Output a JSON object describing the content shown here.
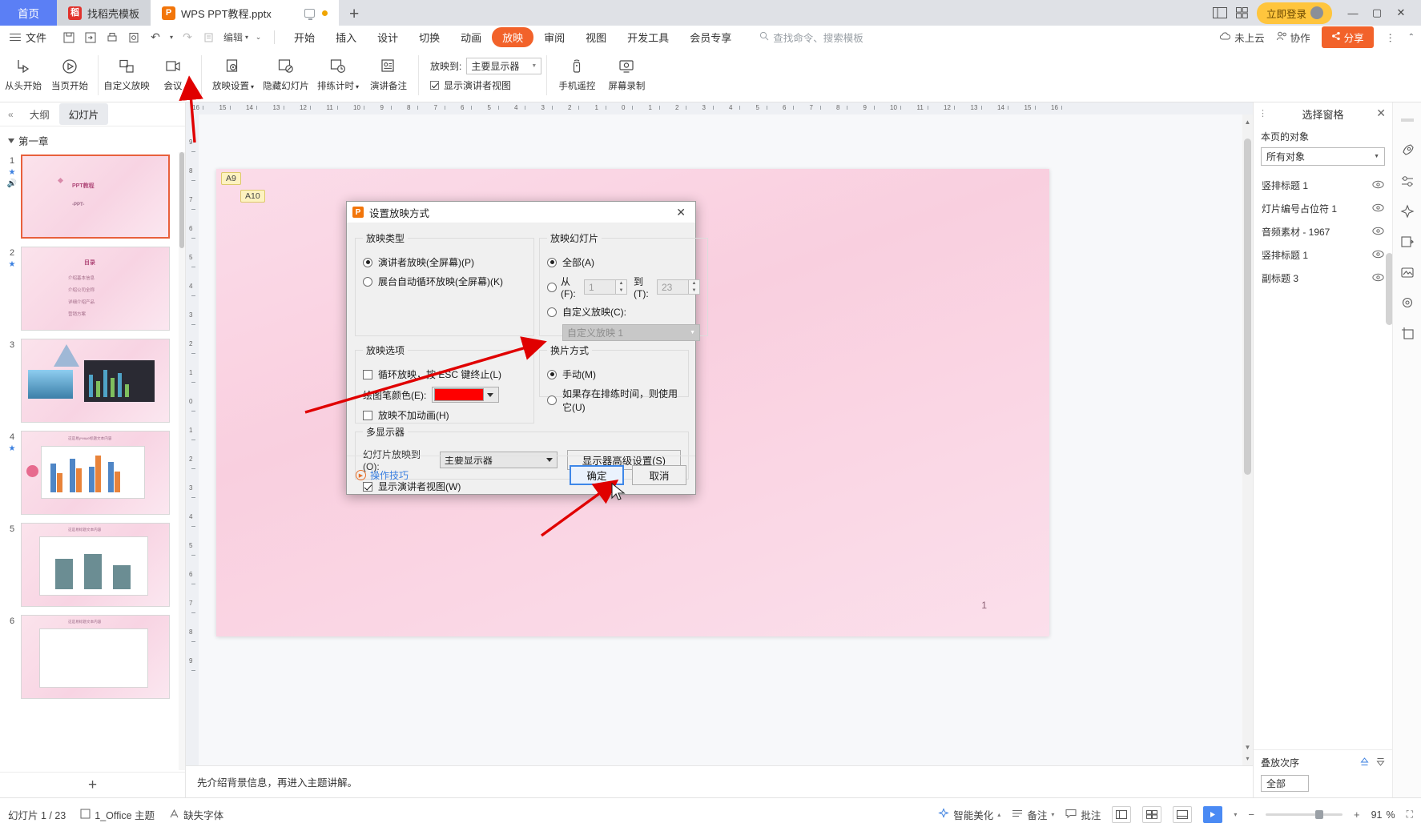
{
  "window": {
    "tabs": [
      {
        "label": "首页",
        "icon": "home-icon",
        "type": "home"
      },
      {
        "label": "找稻壳模板",
        "icon": "daoke-icon",
        "type": "gray"
      },
      {
        "label": "WPS PPT教程.pptx",
        "icon": "wps-ppt-icon",
        "type": "active"
      }
    ],
    "new_tab": "+",
    "login_label": "立即登录",
    "minimize": "—",
    "maximize": "▢",
    "close": "✕"
  },
  "menubar": {
    "file_label": "文件",
    "edit_label": "编辑",
    "tabs": [
      "开始",
      "插入",
      "设计",
      "切换",
      "动画",
      "放映",
      "审阅",
      "视图",
      "开发工具",
      "会员专享"
    ],
    "selected_tab": "放映",
    "search_placeholder": "查找命令、搜索模板",
    "cloud_label": "未上云",
    "collab_label": "协作",
    "share_label": "分享"
  },
  "ribbon": {
    "items": [
      {
        "label": "从头开始",
        "icon": "play-from-start-icon"
      },
      {
        "label": "当页开始",
        "icon": "play-from-current-icon"
      },
      {
        "label": "自定义放映",
        "icon": "custom-show-icon"
      },
      {
        "label": "会议",
        "icon": "meeting-icon"
      },
      {
        "label": "放映设置",
        "icon": "show-settings-icon",
        "dropdown": true
      },
      {
        "label": "隐藏幻灯片",
        "icon": "hide-slide-icon"
      },
      {
        "label": "排练计时",
        "icon": "rehearse-timing-icon",
        "dropdown": true
      },
      {
        "label": "演讲备注",
        "icon": "speaker-notes-icon"
      }
    ],
    "show_to_label": "放映到:",
    "show_to_value": "主要显示器",
    "presenter_view_label": "显示演讲者视图",
    "presenter_view_checked": true,
    "phone_remote": "手机遥控",
    "screen_record": "屏幕录制"
  },
  "left_panel": {
    "tab_outline": "大纲",
    "tab_slides": "幻灯片",
    "selected_tab": "幻灯片",
    "chapter": "第一章",
    "slides": [
      {
        "number": "1",
        "starred": true,
        "audio": true,
        "title": "PPT教程",
        "subtitle": "-PPT-"
      },
      {
        "number": "2",
        "starred": true,
        "title": "目录",
        "bullets": [
          "介绍基本信息",
          "介绍公司全称",
          "详细介绍产品",
          "营销方案"
        ]
      },
      {
        "number": "3",
        "starred": false,
        "title": ""
      },
      {
        "number": "4",
        "starred": true,
        "title": "这是易учные标题文本内容"
      },
      {
        "number": "5",
        "starred": false,
        "title": "这是易标题文本内容"
      },
      {
        "number": "6",
        "starred": false,
        "title": "这是易标题文本内容"
      }
    ],
    "add_slide": "+"
  },
  "ruler": {
    "h_ticks": [
      "16",
      "15",
      "14",
      "13",
      "12",
      "11",
      "10",
      "9",
      "8",
      "7",
      "6",
      "5",
      "4",
      "3",
      "2",
      "1",
      "0",
      "1",
      "2",
      "3",
      "4",
      "5",
      "6",
      "7",
      "8",
      "9",
      "10",
      "11",
      "12",
      "13",
      "14",
      "15",
      "16"
    ],
    "v_ticks": [
      "9",
      "8",
      "7",
      "6",
      "5",
      "4",
      "3",
      "2",
      "1",
      "0",
      "1",
      "2",
      "3",
      "4",
      "5",
      "6",
      "7",
      "8",
      "9"
    ]
  },
  "canvas": {
    "tags": [
      {
        "label": "A9"
      },
      {
        "label": "A10"
      }
    ],
    "slide_number": "1"
  },
  "dialog": {
    "title": "设置放映方式",
    "close": "✕",
    "show_type": {
      "legend": "放映类型",
      "options": [
        {
          "label": "演讲者放映(全屏幕)(P)",
          "selected": true
        },
        {
          "label": "展台自动循环放映(全屏幕)(K)",
          "selected": false
        }
      ]
    },
    "show_options": {
      "legend": "放映选项",
      "loop_label": "循环放映，按 ESC 键终止(L)",
      "loop_checked": false,
      "pen_color_label": "绘图笔颜色(E):",
      "pen_color": "#fe0000",
      "no_anim_label": "放映不加动画(H)",
      "no_anim_checked": false
    },
    "show_slides": {
      "legend": "放映幻灯片",
      "all_label": "全部(A)",
      "all_selected": true,
      "from_label": "从(F):",
      "from_value": "1",
      "to_label": "到(T):",
      "to_value": "23",
      "custom_label": "自定义放映(C):",
      "custom_selected": false,
      "custom_value": "自定义放映 1"
    },
    "advance": {
      "legend": "换片方式",
      "options": [
        {
          "label": "手动(M)",
          "selected": true
        },
        {
          "label": "如果存在排练时间，则使用它(U)",
          "selected": false
        }
      ]
    },
    "multi_monitor": {
      "legend": "多显示器",
      "display_label": "幻灯片放映到(O):",
      "display_value": "主要显示器",
      "advanced_button": "显示器高级设置(S)",
      "presenter_view_label": "显示演讲者视图(W)",
      "presenter_view_checked": true
    },
    "tips_label": "操作技巧",
    "ok_button": "确定",
    "cancel_button": "取消"
  },
  "right_panel": {
    "title": "选择窗格",
    "close": "✕",
    "subtitle": "本页的对象",
    "filter_value": "所有对象",
    "objects": [
      {
        "name": "竖排标题 1"
      },
      {
        "name": "灯片编号占位符 1"
      },
      {
        "name": "音频素材 - 1967"
      },
      {
        "name": "竖排标题 1"
      },
      {
        "name": "副标题 3"
      }
    ],
    "stack_label": "叠放次序",
    "all_label": "全部"
  },
  "notes": {
    "text": "先介绍背景信息，再进入主题讲解。"
  },
  "statusbar": {
    "slide_count": "幻灯片 1 / 23",
    "theme": "1_Office 主题",
    "missing_font": "缺失字体",
    "beautify": "智能美化",
    "notes": "备注",
    "comments": "批注",
    "zoom_value": "91",
    "zoom_percent": "%"
  },
  "colors": {
    "accent_orange": "#f2622a",
    "tab_blue": "#5b7ff5",
    "pen_red": "#fe0000",
    "annotation_red": "#e00000",
    "dialog_focus_blue": "#3e87e8"
  }
}
